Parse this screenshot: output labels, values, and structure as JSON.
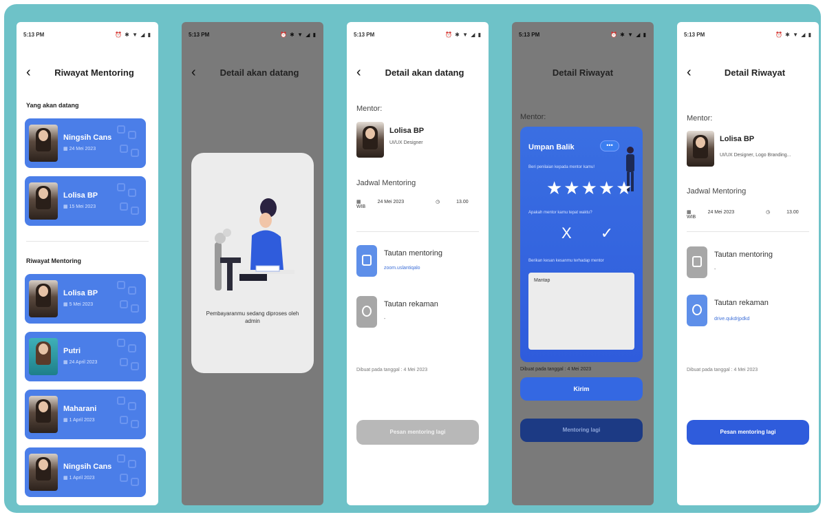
{
  "status": {
    "time": "5:13 PM",
    "icons": "⏰ ✱ ▼ ◢ ▮"
  },
  "screen1": {
    "title": "Riwayat Mentoring",
    "upcoming_label": "Yang akan datang",
    "upcoming": [
      {
        "name": "Ningsih Cans",
        "date": "24 Mei 2023"
      },
      {
        "name": "Lolisa BP",
        "date": "15 Mei 2023"
      }
    ],
    "history_label": "Riwayat Mentoring",
    "history": [
      {
        "name": "Lolisa BP",
        "date": "5 Mei 2023"
      },
      {
        "name": "Putri",
        "date": "24 April 2023"
      },
      {
        "name": "Maharani",
        "date": "1 April 2023"
      },
      {
        "name": "Ningsih Cans",
        "date": "1 April 2023"
      }
    ]
  },
  "screen2": {
    "title": "Detail akan datang",
    "message": "Pembayaranmu sedang diproses oleh admin"
  },
  "screen3": {
    "title": "Detail akan datang",
    "mentor_label": "Mentor:",
    "mentor_name": "Lolisa BP",
    "mentor_role": "UI/UX Designer",
    "schedule_label": "Jadwal Mentoring",
    "date": "24 Mei 2023",
    "time": "13.00 WIB",
    "link1_title": "Tautan mentoring",
    "link1_sub": "zoom.uslantiqalo",
    "link2_title": "Tautan rekaman",
    "link2_sub": "-",
    "created": "Dibuat pada tanggal : 4 Mei 2023",
    "button": "Pesan mentoring lagi"
  },
  "screen4": {
    "title": "Detail Riwayat",
    "mentor_label": "Mentor:",
    "feedback_title": "Umpan Balik",
    "bubble": "•••",
    "q1": "Beri penilaian kepada mentor kamu!",
    "stars": "★★★★★",
    "q2": "Apakah mentor kamu tepat waktu?",
    "yn": "X ✓",
    "q3": "Berikan kesan kesanmu terhadap mentor",
    "textarea": "Mantap",
    "created": "Dibuat pada tanggal : 4 Mei 2023",
    "send": "Kirim",
    "again": "Mentoring lagi"
  },
  "screen5": {
    "title": "Detail Riwayat",
    "mentor_label": "Mentor:",
    "mentor_name": "Lolisa BP",
    "mentor_role": "UI/UX Designer, Logo Branding...",
    "schedule_label": "Jadwal Mentoring",
    "date": "24 Mei 2023",
    "time": "13.00 WIB",
    "link1_title": "Tautan mentoring",
    "link1_sub": "-",
    "link2_title": "Tautan rekaman",
    "link2_sub": "drive.qukdrjpdkd",
    "created": "Dibuat pada tanggal : 4 Mei 2023",
    "button": "Pesan mentoring lagi"
  }
}
